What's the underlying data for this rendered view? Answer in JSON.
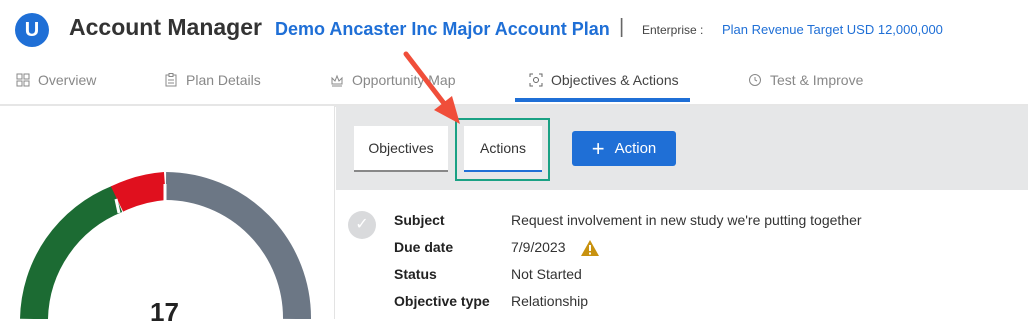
{
  "header": {
    "app_title": "Account Manager",
    "plan_title": "Demo Ancaster Inc Major Account Plan",
    "separator": "|",
    "enterprise_label": "Enterprise :",
    "enterprise_value": "Plan Revenue Target USD 12,000,000",
    "logo_letter": "U",
    "brand_color": "#1f6fd6"
  },
  "tabs": [
    {
      "label": "Overview",
      "icon": "grid-icon"
    },
    {
      "label": "Plan Details",
      "icon": "clipboard-icon"
    },
    {
      "label": "Opportunity Map",
      "icon": "crown-icon"
    },
    {
      "label": "Objectives & Actions",
      "icon": "target-icon",
      "active": true
    },
    {
      "label": "Test & Improve",
      "icon": "refresh-icon"
    }
  ],
  "summary": {
    "count": "17",
    "segments": [
      {
        "name": "green",
        "color": "#1c6b33"
      },
      {
        "name": "red",
        "color": "#e0101e"
      },
      {
        "name": "gray",
        "color": "#6c7785"
      }
    ]
  },
  "subtabs": {
    "objectives": "Objectives",
    "actions": "Actions",
    "add_action": "Action"
  },
  "details": {
    "subject_label": "Subject",
    "subject_value": "Request involvement in new study we're putting together",
    "due_label": "Due date",
    "due_value": "7/9/2023",
    "status_label": "Status",
    "status_value": "Not Started",
    "type_label": "Objective type",
    "type_value": "Relationship"
  }
}
